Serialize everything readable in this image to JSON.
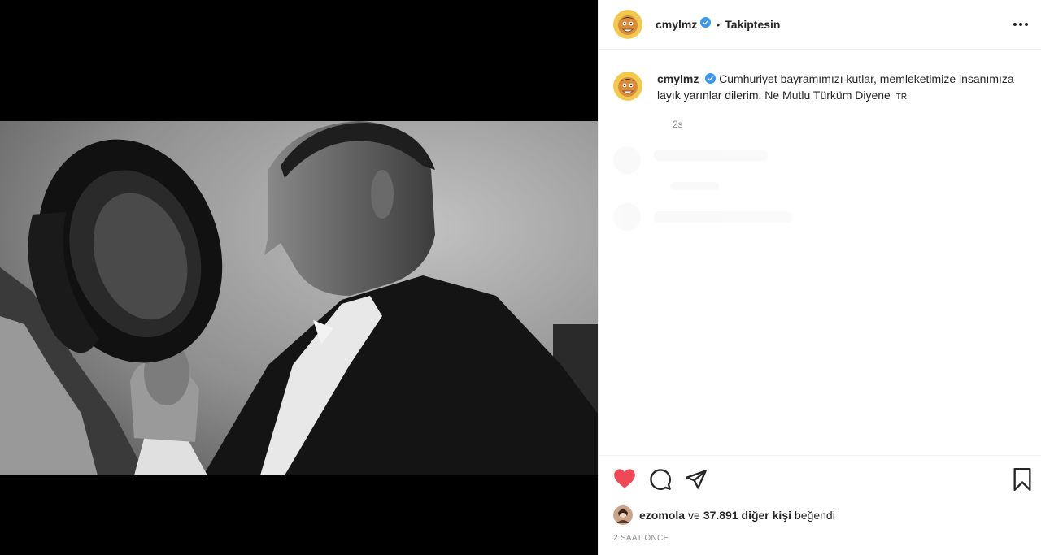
{
  "post": {
    "username": "cmylmz",
    "follow_status": "Takiptesin",
    "bullet": "•",
    "caption": "Cumhuriyet bayramımızı kutlar, memleketimize insanımıza layık yarınlar dilerim. Ne Mutlu Türküm Diyene",
    "caption_flag": "TR",
    "caption_time": "2s",
    "liked_by_user": "ezomola",
    "likes_connector": "ve",
    "likes_count": "37.891 diğer kişi",
    "likes_suffix": "beğendi",
    "time_ago": "2 SAAT ÖNCE"
  },
  "colors": {
    "like_red": "#ed4956",
    "verified_blue": "#3897f0",
    "muted": "#8e8e8e",
    "text": "#262626"
  },
  "icons": [
    "more-options-icon",
    "verified-icon",
    "heart-icon",
    "comment-icon",
    "share-icon",
    "bookmark-icon"
  ]
}
